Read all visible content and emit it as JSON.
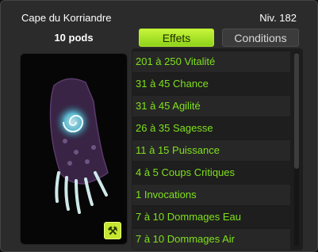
{
  "item": {
    "name": "Cape du Korriandre",
    "level": "Niv. 182",
    "weight": "10 pods"
  },
  "tabs": {
    "effects": "Effets",
    "conditions": "Conditions"
  },
  "icons": {
    "craft": "craft-hammer-icon"
  },
  "colors": {
    "effect_text": "#7fe01c",
    "active_tab": "#b6ec2c"
  },
  "effects": [
    "201 à 250 Vitalité",
    "31 à 45 Chance",
    "31 à 45 Agilité",
    "26 à 35 Sagesse",
    "11 à 15 Puissance",
    "4 à 5 Coups Critiques",
    "1 Invocations",
    "7 à 10 Dommages Eau",
    "7 à 10 Dommages Air"
  ]
}
